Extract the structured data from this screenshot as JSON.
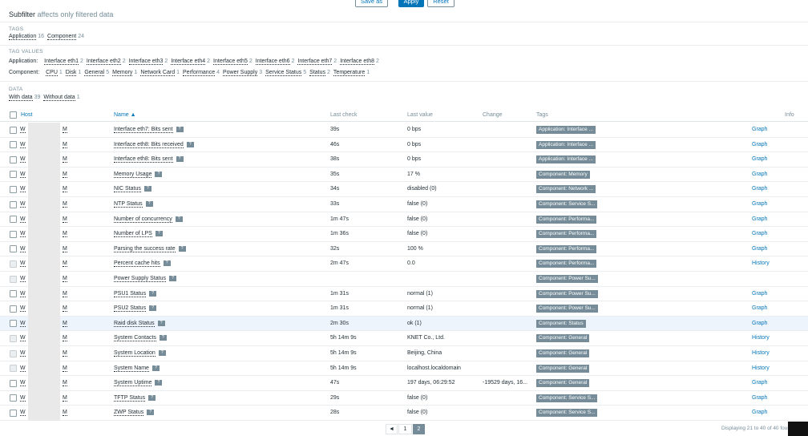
{
  "filter_buttons": {
    "save_as": "Save as",
    "apply": "Apply",
    "reset": "Reset"
  },
  "subfilter": {
    "title": "Subfilter",
    "subtitle": "affects only filtered data"
  },
  "tags": {
    "heading": "TAGS",
    "items": [
      {
        "label": "Application",
        "count": "16"
      },
      {
        "label": "Component",
        "count": "24"
      }
    ]
  },
  "tag_values": {
    "heading": "TAG VALUES",
    "application": {
      "label": "Application:",
      "items": [
        {
          "label": "Interface eth1",
          "count": "2"
        },
        {
          "label": "Interface eth2",
          "count": "2"
        },
        {
          "label": "Interface eth3",
          "count": "2"
        },
        {
          "label": "Interface eth4",
          "count": "2"
        },
        {
          "label": "Interface eth5",
          "count": "2"
        },
        {
          "label": "Interface eth6",
          "count": "2"
        },
        {
          "label": "Interface eth7",
          "count": "2"
        },
        {
          "label": "Interface eth8",
          "count": "2"
        }
      ]
    },
    "component": {
      "label": "Component:",
      "items": [
        {
          "label": "CPU",
          "count": "1"
        },
        {
          "label": "Disk",
          "count": "1"
        },
        {
          "label": "General",
          "count": "5"
        },
        {
          "label": "Memory",
          "count": "1"
        },
        {
          "label": "Network Card",
          "count": "1"
        },
        {
          "label": "Performance",
          "count": "4"
        },
        {
          "label": "Power Supply",
          "count": "3"
        },
        {
          "label": "Service Status",
          "count": "5"
        },
        {
          "label": "Status",
          "count": "2"
        },
        {
          "label": "Temperature",
          "count": "1"
        }
      ]
    }
  },
  "data_filter": {
    "heading": "DATA",
    "items": [
      {
        "label": "With data",
        "count": "39"
      },
      {
        "label": "Without data",
        "count": "1"
      }
    ]
  },
  "table": {
    "headers": {
      "host": "Host",
      "name": "Name ▲",
      "last_check": "Last check",
      "last_value": "Last value",
      "change": "Change",
      "tags": "Tags",
      "info": "Info"
    },
    "rows": [
      {
        "host_a": "W",
        "host_b": "M",
        "name": "Interface eth7: Bits sent",
        "last_check": "39s",
        "last_value": "0 bps",
        "change": "",
        "tag": "Application: Interface ...",
        "action": "Graph",
        "disabled": false,
        "highlight": false
      },
      {
        "host_a": "W",
        "host_b": "M",
        "name": "Interface eth8: Bits received",
        "last_check": "46s",
        "last_value": "0 bps",
        "change": "",
        "tag": "Application: Interface ...",
        "action": "Graph",
        "disabled": false,
        "highlight": false
      },
      {
        "host_a": "W",
        "host_b": "M",
        "name": "Interface eth8: Bits sent",
        "last_check": "38s",
        "last_value": "0 bps",
        "change": "",
        "tag": "Application: Interface ...",
        "action": "Graph",
        "disabled": false,
        "highlight": false
      },
      {
        "host_a": "W",
        "host_b": "M",
        "name": "Memory Usage",
        "last_check": "35s",
        "last_value": "17 %",
        "change": "",
        "tag": "Component: Memory",
        "action": "Graph",
        "disabled": false,
        "highlight": false
      },
      {
        "host_a": "W",
        "host_b": "M",
        "name": "NIC Status",
        "last_check": "34s",
        "last_value": "disabled (0)",
        "change": "",
        "tag": "Component: Network ...",
        "action": "Graph",
        "disabled": false,
        "highlight": false
      },
      {
        "host_a": "W",
        "host_b": "M",
        "name": "NTP Status",
        "last_check": "33s",
        "last_value": "false (0)",
        "change": "",
        "tag": "Component: Service S...",
        "action": "Graph",
        "disabled": false,
        "highlight": false
      },
      {
        "host_a": "W",
        "host_b": "M",
        "name": "Number of concurrency",
        "last_check": "1m 47s",
        "last_value": "false (0)",
        "change": "",
        "tag": "Component: Performa...",
        "action": "Graph",
        "disabled": false,
        "highlight": false
      },
      {
        "host_a": "W",
        "host_b": "M",
        "name": "Number of LPS",
        "last_check": "1m 36s",
        "last_value": "false (0)",
        "change": "",
        "tag": "Component: Performa...",
        "action": "Graph",
        "disabled": false,
        "highlight": false
      },
      {
        "host_a": "W",
        "host_b": "M",
        "name": "Parsing the success rate",
        "last_check": "32s",
        "last_value": "100 %",
        "change": "",
        "tag": "Component: Performa...",
        "action": "Graph",
        "disabled": false,
        "highlight": false
      },
      {
        "host_a": "W",
        "host_b": "M",
        "name": "Percent cache hits",
        "last_check": "2m 47s",
        "last_value": "0.0",
        "change": "",
        "tag": "Component: Performa...",
        "action": "History",
        "disabled": true,
        "highlight": false
      },
      {
        "host_a": "W",
        "host_b": "M",
        "name": "Power Supply Status",
        "last_check": "",
        "last_value": "",
        "change": "",
        "tag": "Component: Power Su...",
        "action": "",
        "disabled": true,
        "highlight": false
      },
      {
        "host_a": "W",
        "host_b": "M",
        "name": "PSU1 Status",
        "last_check": "1m 31s",
        "last_value": "normal (1)",
        "change": "",
        "tag": "Component: Power Su...",
        "action": "Graph",
        "disabled": false,
        "highlight": false
      },
      {
        "host_a": "W",
        "host_b": "M",
        "name": "PSU2 Status",
        "last_check": "1m 31s",
        "last_value": "normal (1)",
        "change": "",
        "tag": "Component: Power Su...",
        "action": "Graph",
        "disabled": false,
        "highlight": false
      },
      {
        "host_a": "W",
        "host_b": "M",
        "name": "Raid disk Status",
        "last_check": "2m 30s",
        "last_value": "ok (1)",
        "change": "",
        "tag": "Component: Status",
        "action": "Graph",
        "disabled": false,
        "highlight": true
      },
      {
        "host_a": "W",
        "host_b": "M",
        "name": "System Contacts",
        "last_check": "5h 14m 9s",
        "last_value": "KNET Co., Ltd.",
        "change": "",
        "tag": "Component: General",
        "action": "History",
        "disabled": true,
        "highlight": false
      },
      {
        "host_a": "W",
        "host_b": "M",
        "name": "System Location",
        "last_check": "5h 14m 9s",
        "last_value": "Beijing, China",
        "change": "",
        "tag": "Component: General",
        "action": "History",
        "disabled": true,
        "highlight": false
      },
      {
        "host_a": "W",
        "host_b": "M",
        "name": "System Name",
        "last_check": "5h 14m 9s",
        "last_value": "localhost.localdomain",
        "change": "",
        "tag": "Component: General",
        "action": "History",
        "disabled": true,
        "highlight": false
      },
      {
        "host_a": "W",
        "host_b": "M",
        "name": "System Uptime",
        "last_check": "47s",
        "last_value": "197 days, 06:29:52",
        "change": "-19529 days, 16...",
        "tag": "Component: General",
        "action": "Graph",
        "disabled": false,
        "highlight": false
      },
      {
        "host_a": "W",
        "host_b": "M",
        "name": "TFTP Status",
        "last_check": "29s",
        "last_value": "false (0)",
        "change": "",
        "tag": "Component: Service S...",
        "action": "Graph",
        "disabled": false,
        "highlight": false
      },
      {
        "host_a": "W",
        "host_b": "M",
        "name": "ZWP Status",
        "last_check": "28s",
        "last_value": "false (0)",
        "change": "",
        "tag": "Component: Service S...",
        "action": "Graph",
        "disabled": false,
        "highlight": false
      }
    ]
  },
  "pagination": {
    "prev": "◄",
    "pages": [
      "1",
      "2"
    ],
    "current": "2"
  },
  "footer": {
    "displaying": "Displaying 21 to 40 of 40 found"
  },
  "colors": {
    "accent": "#0275b8",
    "tag_bg": "#768d99",
    "highlight_row": "#eef4fc"
  }
}
